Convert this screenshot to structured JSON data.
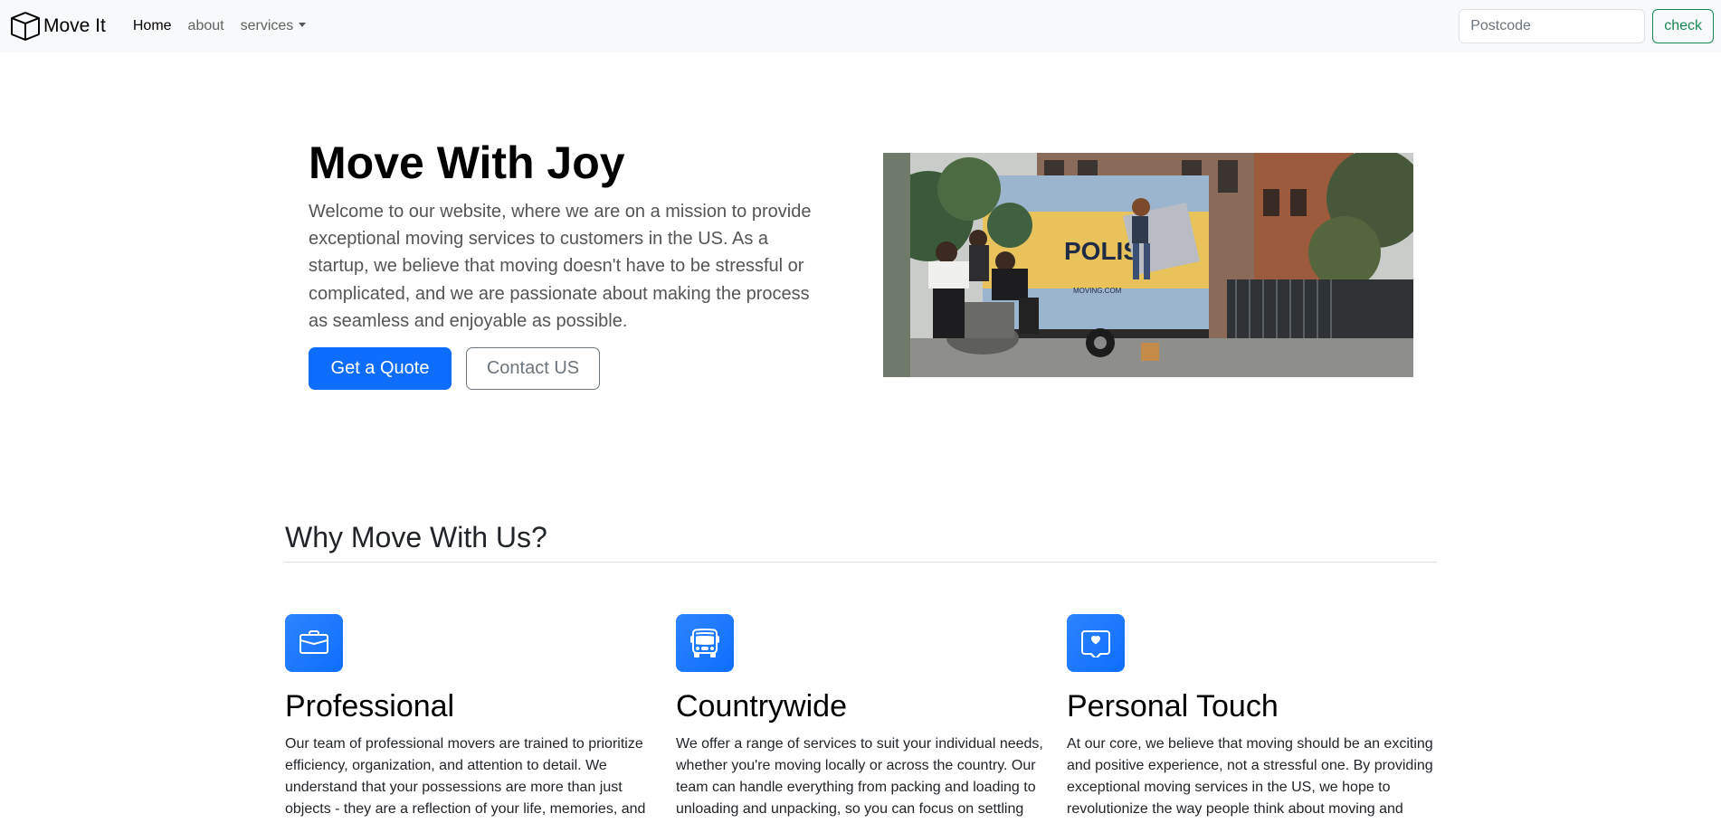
{
  "navbar": {
    "brand": "Move It",
    "links": [
      {
        "label": "Home"
      },
      {
        "label": "about"
      },
      {
        "label": "services"
      }
    ],
    "search_placeholder": "Postcode",
    "check_label": "check"
  },
  "hero": {
    "title": "Move With Joy",
    "lead": "Welcome to our website, where we are on a mission to provide exceptional moving services to customers in the US. As a startup, we believe that moving doesn't have to be stressful or complicated, and we are passionate about making the process as seamless and enjoyable as possible.",
    "primary_button": "Get a Quote",
    "secondary_button": "Contact US",
    "image": {
      "truck_sign": "POLIS",
      "truck_small_text": "MOVING.COM"
    }
  },
  "features": {
    "heading": "Why Move With Us?",
    "items": [
      {
        "icon": "briefcase-icon",
        "title": "Professional",
        "text": "Our team of professional movers are trained to prioritize efficiency, organization, and attention to detail. We understand that your possessions are more than just objects - they are a reflection of your life, memories, and experiences. That's why we take extra care to ensure that"
      },
      {
        "icon": "bus-icon",
        "title": "Countrywide",
        "text": "We offer a range of services to suit your individual needs, whether you're moving locally or across the country. Our team can handle everything from packing and loading to unloading and unpacking, so you can focus on settling into your new home while we take care of the rest"
      },
      {
        "icon": "chat-heart-icon",
        "title": "Personal Touch",
        "text": "At our core, we believe that moving should be an exciting and positive experience, not a stressful one. By providing exceptional moving services in the US, we hope to revolutionize the way people think about moving and make it a joyous occasion for all who choose our services"
      }
    ]
  },
  "colors": {
    "primary": "#0d6efd",
    "success": "#198754",
    "navbar_bg": "#f8f9fa"
  }
}
